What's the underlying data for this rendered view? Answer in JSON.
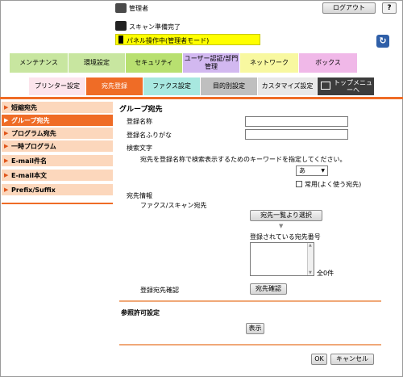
{
  "header": {
    "user_label": "管理者",
    "logout_label": "ログアウト",
    "help_label": "?",
    "status_scan": "スキャン準備完了",
    "status_panel": "パネル操作中(管理者モード)"
  },
  "top_tabs": [
    {
      "label": "メンテナンス",
      "color": "#c8e6a0"
    },
    {
      "label": "環境設定",
      "color": "#c8e6a0"
    },
    {
      "label": "セキュリティ",
      "color": "#b8e070"
    },
    {
      "label": "ユーザー認証/部門管理",
      "color": "#d2b8f0"
    },
    {
      "label": "ネットワーク",
      "color": "#f8f8a0"
    },
    {
      "label": "ボックス",
      "color": "#f0b8e8"
    }
  ],
  "sub_tabs": [
    {
      "label": "プリンター設定",
      "color": "#fce4ec"
    },
    {
      "label": "宛先登録",
      "color": "#ef6c26",
      "active": true
    },
    {
      "label": "ファクス設定",
      "color": "#a8e8e0"
    },
    {
      "label": "目的別設定",
      "color": "#bfbfbf"
    },
    {
      "label": "カスタマイズ設定",
      "color": "#e8e8e8"
    }
  ],
  "top_menu_label": "トップメニューへ",
  "sidebar": {
    "items": [
      {
        "label": "短縮宛先",
        "active": false
      },
      {
        "label": "グループ宛先",
        "active": true
      },
      {
        "label": "プログラム宛先",
        "active": false
      },
      {
        "label": "一時プログラム",
        "active": false
      },
      {
        "label": "E-mail件名",
        "active": false
      },
      {
        "label": "E-mail本文",
        "active": false
      },
      {
        "label": "Prefix/Suffix",
        "active": false
      }
    ]
  },
  "form": {
    "title": "グループ宛先",
    "name_label": "登録名称",
    "name_value": "",
    "furigana_label": "登録名ふりがな",
    "furigana_value": "",
    "search_label": "検索文字",
    "search_desc": "宛先を登録名称で検索表示するためのキーワードを指定してください。",
    "search_select_value": "あ",
    "frequent_label": "常用(よく使う宛先)",
    "dest_info_label": "宛先情報",
    "fax_scan_label": "ファクス/スキャン宛先",
    "select_from_list_button": "宛先一覧より選択",
    "registered_label": "登録されている宛先番号",
    "count_label": "全0件",
    "confirm_label": "登録宛先確認",
    "confirm_button": "宛先確認",
    "ref_title": "参照許可設定",
    "show_button": "表示",
    "ok_button": "OK",
    "cancel_button": "キャンセル"
  }
}
